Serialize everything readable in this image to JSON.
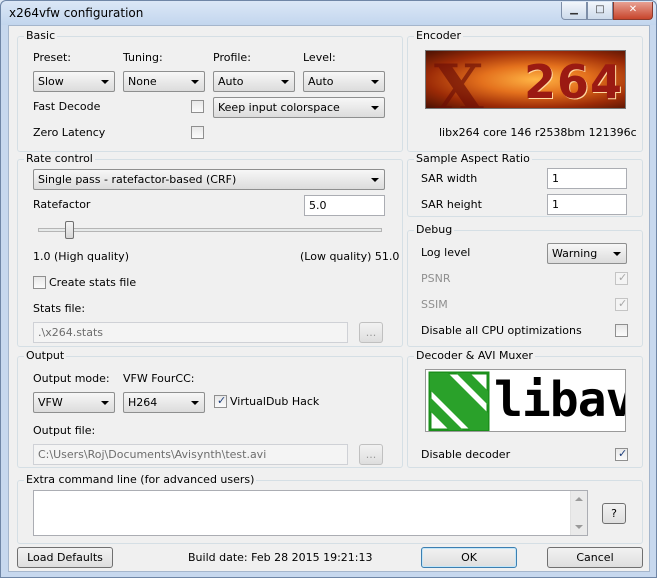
{
  "window": {
    "title": "x264vfw configuration",
    "minimize": "▁",
    "maximize": "□",
    "close": "✕"
  },
  "basic": {
    "group_label": "Basic",
    "preset_label": "Preset:",
    "preset_value": "Slow",
    "tuning_label": "Tuning:",
    "tuning_value": "None",
    "profile_label": "Profile:",
    "profile_value": "Auto",
    "level_label": "Level:",
    "level_value": "Auto",
    "fast_decode_label": "Fast Decode",
    "fast_decode_checked": false,
    "zero_latency_label": "Zero Latency",
    "zero_latency_checked": false,
    "colorspace_value": "Keep input colorspace"
  },
  "encoder": {
    "group_label": "Encoder",
    "logo_text": "264",
    "version_text": "libx264 core 146 r2538bm 121396c"
  },
  "rate_control": {
    "group_label": "Rate control",
    "mode_value": "Single pass - ratefactor-based (CRF)",
    "ratefactor_label": "Ratefactor",
    "ratefactor_value": "5.0",
    "slider_fraction": 0.08,
    "min_label": "1.0 (High quality)",
    "max_label": "(Low quality) 51.0",
    "create_stats_label": "Create stats file",
    "create_stats_checked": false,
    "stats_file_label": "Stats file:",
    "stats_file_value": ".\\x264.stats",
    "browse_label": "..."
  },
  "sar": {
    "group_label": "Sample Aspect Ratio",
    "width_label": "SAR width",
    "width_value": "1",
    "height_label": "SAR height",
    "height_value": "1"
  },
  "debug": {
    "group_label": "Debug",
    "log_level_label": "Log level",
    "log_level_value": "Warning",
    "psnr_label": "PSNR",
    "ssim_label": "SSIM",
    "disable_cpu_label": "Disable all CPU optimizations",
    "check_mark": "✓"
  },
  "output": {
    "group_label": "Output",
    "mode_label": "Output mode:",
    "mode_value": "VFW",
    "fourcc_label": "VFW FourCC:",
    "fourcc_value": "H264",
    "vdub_label": "VirtualDub Hack",
    "vdub_checked": true,
    "file_label": "Output file:",
    "file_value": "C:\\Users\\Roj\\Documents\\Avisynth\\test.avi",
    "browse_label": "..."
  },
  "decoder": {
    "group_label": "Decoder & AVI Muxer",
    "logo_text": "libav",
    "disable_decoder_label": "Disable decoder",
    "disable_decoder_checked": true
  },
  "extra": {
    "group_label": "Extra command line (for advanced users)",
    "help_label": "?"
  },
  "footer": {
    "load_defaults": "Load Defaults",
    "build_date": "Build date: Feb 28 2015 19:21:13",
    "ok": "OK",
    "cancel": "Cancel"
  }
}
